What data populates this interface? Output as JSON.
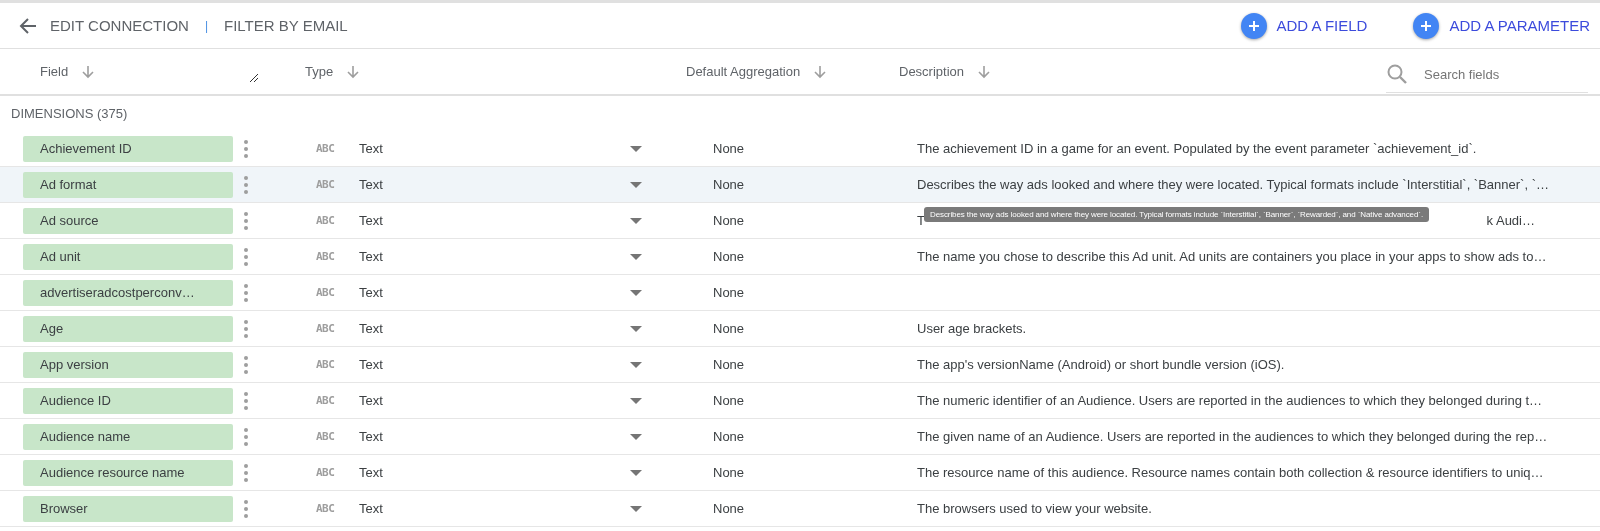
{
  "toolbar": {
    "back": "EDIT CONNECTION",
    "separator": "|",
    "title": "FILTER BY EMAIL",
    "buttons": [
      {
        "label": "ADD A FIELD"
      },
      {
        "label": "ADD A PARAMETER"
      }
    ]
  },
  "table": {
    "columns": [
      "Field",
      "Type",
      "Default Aggregation",
      "Description"
    ],
    "search": {
      "placeholder": "Search fields"
    },
    "section": "DIMENSIONS (375)",
    "rows": [
      {
        "field": "Achievement ID",
        "type_icon": "ABC",
        "type": "Text",
        "aggregation": "None",
        "description": "The achievement ID in a game for an event. Populated by the event parameter `achievement_id`.",
        "highlighted": false
      },
      {
        "field": "Ad format",
        "type_icon": "ABC",
        "type": "Text",
        "aggregation": "None",
        "description": "Describes the way ads looked and where they were located. Typical formats include `Interstitial`, `Banner`, `…",
        "highlighted": true
      },
      {
        "field": "Ad source",
        "type_icon": "ABC",
        "type": "Text",
        "aggregation": "None",
        "description": "T",
        "description_end": "k Audi…",
        "tooltip": "Describes the way ads looked and where they were located. Typical formats include `Interstitial`, `Banner`, `Rewarded`, and `Native advanced`.",
        "highlighted": false
      },
      {
        "field": "Ad unit",
        "type_icon": "ABC",
        "type": "Text",
        "aggregation": "None",
        "description": "The name you chose to describe this Ad unit. Ad units are containers you place in your apps to show ads to…",
        "highlighted": false
      },
      {
        "field": "advertiseradcostperconv…",
        "type_icon": "ABC",
        "type": "Text",
        "aggregation": "None",
        "highlighted": false
      },
      {
        "field": "Age",
        "type_icon": "ABC",
        "type": "Text",
        "aggregation": "None",
        "description": "User age brackets.",
        "highlighted": false
      },
      {
        "field": "App version",
        "type_icon": "ABC",
        "type": "Text",
        "aggregation": "None",
        "description": "The app's versionName (Android) or short bundle version (iOS).",
        "highlighted": false
      },
      {
        "field": "Audience ID",
        "type_icon": "ABC",
        "type": "Text",
        "aggregation": "None",
        "description": "The numeric identifier of an Audience. Users are reported in the audiences to which they belonged during t…",
        "highlighted": false
      },
      {
        "field": "Audience name",
        "type_icon": "ABC",
        "type": "Text",
        "aggregation": "None",
        "description": "The given name of an Audience. Users are reported in the audiences to which they belonged during the rep…",
        "highlighted": false
      },
      {
        "field": "Audience resource name",
        "type_icon": "ABC",
        "type": "Text",
        "aggregation": "None",
        "description": "The resource name of this audience. Resource names contain both collection & resource identifiers to uniq…",
        "highlighted": false
      },
      {
        "field": "Browser",
        "type_icon": "ABC",
        "type": "Text",
        "aggregation": "None",
        "description": "The browsers used to view your website.",
        "highlighted": false
      }
    ]
  }
}
